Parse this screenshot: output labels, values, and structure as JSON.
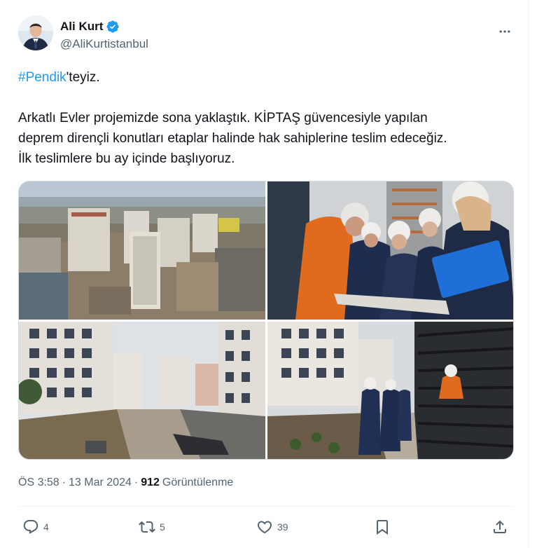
{
  "author": {
    "display_name": "Ali Kurt",
    "handle": "@AliKurtistanbul",
    "verified": true
  },
  "tweet": {
    "hashtag": "#Pendik",
    "first_line_rest": "'teyiz.",
    "line2": "Arkatlı Evler projemizde sona yaklaştık. KİPTAŞ güvencesiyle yapılan",
    "line3": "deprem dirençli konutları etaplar halinde hak sahiplerine teslim edeceğiz.",
    "line4": "İlk teslimlere bu ay içinde başlıyoruz."
  },
  "media": [
    {
      "icon": "photo-aerial-construction-site"
    },
    {
      "icon": "photo-workers-reviewing-plans"
    },
    {
      "icon": "photo-residential-courtyard"
    },
    {
      "icon": "photo-officials-walking-garden"
    }
  ],
  "meta": {
    "time": "ÖS 3:58",
    "separator": "·",
    "date": "13 Mar 2024",
    "views_count": "912",
    "views_label": "Görüntülenme"
  },
  "actions": {
    "replies": "4",
    "retweets": "5",
    "likes": "39"
  },
  "colors": {
    "accent": "#1d9bf0",
    "text": "#0f1419",
    "secondary": "#536471",
    "border": "#cfd9de"
  }
}
